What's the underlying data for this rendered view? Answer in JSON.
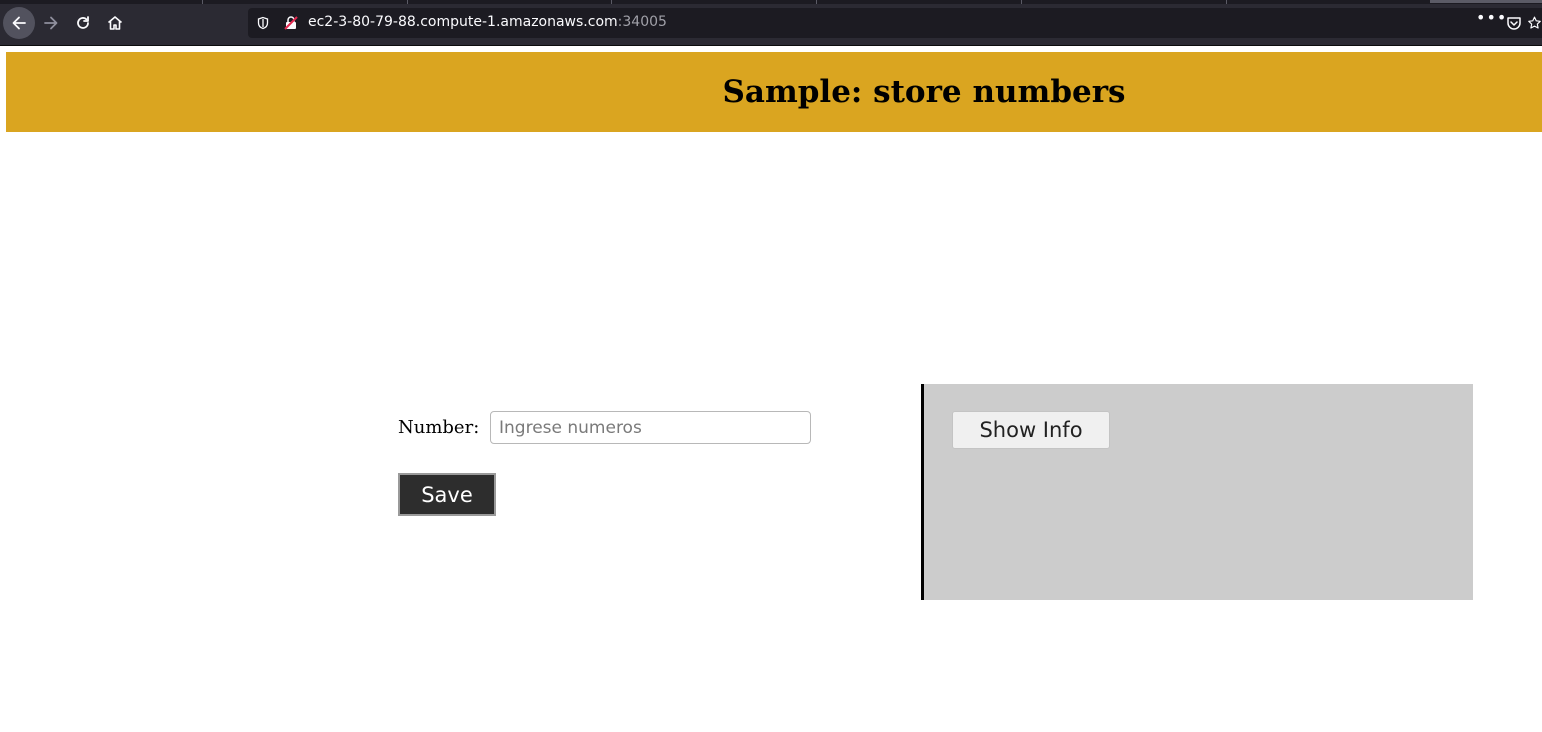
{
  "browser": {
    "url_host": "ec2-3-80-79-88.compute-1.amazonaws.com",
    "url_port": ":34005",
    "menu_dots": "•••",
    "icons": [
      "back-arrow-icon",
      "forward-arrow-icon",
      "reload-icon",
      "home-icon",
      "tracking-shield-icon",
      "insecure-lock-icon",
      "pocket-icon",
      "bookmark-star-icon"
    ]
  },
  "header": {
    "title": "Sample: store numbers",
    "background_color": "#daa520"
  },
  "form": {
    "number_label": "Number:",
    "number_placeholder": "Ingrese numeros",
    "number_value": "",
    "save_label": "Save"
  },
  "info_panel": {
    "show_info_label": "Show Info",
    "background_color": "#cccccc"
  }
}
